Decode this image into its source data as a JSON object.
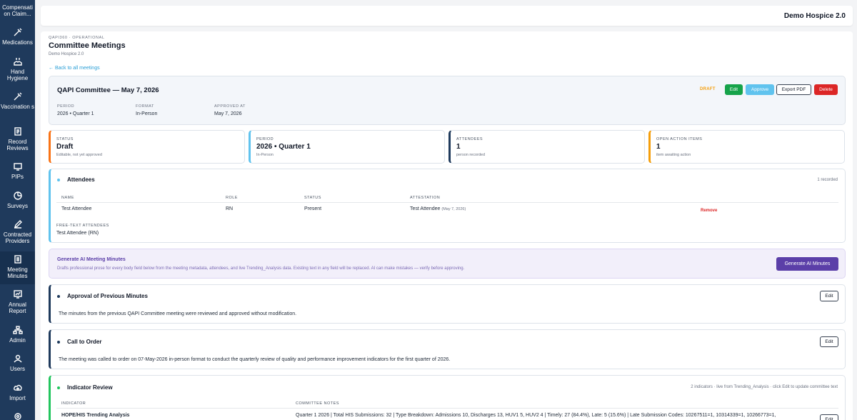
{
  "sidebar": {
    "items": [
      {
        "label": "Compensati on Claim...",
        "icon": "document-icon"
      },
      {
        "label": "Medications",
        "icon": "syringe-icon"
      },
      {
        "label": "Hand Hygiene",
        "icon": "hands-icon"
      },
      {
        "label": "Vaccination s",
        "icon": "syringe-icon"
      },
      {
        "label": "Record Reviews",
        "icon": "clipboard-icon"
      },
      {
        "label": "PIPs",
        "icon": "monitor-icon"
      },
      {
        "label": "Surveys",
        "icon": "pie-icon"
      },
      {
        "label": "Contracted Providers",
        "icon": "pen-icon"
      },
      {
        "label": "Meeting Minutes",
        "icon": "notes-icon"
      },
      {
        "label": "Annual Report",
        "icon": "report-icon"
      },
      {
        "label": "Admin",
        "icon": "sitemap-icon"
      },
      {
        "label": "Users",
        "icon": "user-icon"
      },
      {
        "label": "Import",
        "icon": "cloud-upload-icon"
      }
    ]
  },
  "topbar": {
    "org": "Demo Hospice 2.0"
  },
  "page": {
    "eyebrow": "QAPI360 · OPERATIONAL",
    "title": "Committee Meetings",
    "subtitle": "Demo Hospice 2.0",
    "back": "← Back to all meetings"
  },
  "meeting": {
    "title": "QAPI Committee — May 7, 2026",
    "status_badge": "DRAFT",
    "buttons": {
      "edit": "Edit",
      "approve": "Approve",
      "export": "Export PDF",
      "delete": "Delete"
    },
    "meta": [
      {
        "label": "PERIOD",
        "value": "2026 • Quarter 1"
      },
      {
        "label": "FORMAT",
        "value": "In-Person"
      },
      {
        "label": "APPROVED AT",
        "value": "May 7, 2026"
      }
    ]
  },
  "stats": [
    {
      "label": "STATUS",
      "value": "Draft",
      "sub": "Editable, not yet approved",
      "color": "#f97316"
    },
    {
      "label": "PERIOD",
      "value": "2026 • Quarter 1",
      "sub": "In-Person",
      "color": "#60c3ee"
    },
    {
      "label": "ATTENDEES",
      "value": "1",
      "sub": "person recorded",
      "color": "#1f3a5c"
    },
    {
      "label": "OPEN ACTION ITEMS",
      "value": "1",
      "sub": "item awaiting action",
      "color": "#f59e0b"
    }
  ],
  "attendees": {
    "title": "Attendees",
    "count": "1 recorded",
    "headers": [
      "NAME",
      "ROLE",
      "STATUS",
      "ATTESTATION"
    ],
    "row": {
      "name": "Test Attendee",
      "role": "RN",
      "status": "Present",
      "attestation": "Test Attendee",
      "attestation_date": "(May 7, 2026)",
      "remove": "Remove"
    },
    "free_text_label": "FREE-TEXT ATTENDEES",
    "free_text_value": "Test Attendee (RN)"
  },
  "ai": {
    "title": "Generate AI Meeting Minutes",
    "desc": "Drafts professional prose for every body field below from the meeting metadata, attendees, and live Trending_Analysis data. Existing text in any field will be replaced. AI can make mistakes — verify before approving.",
    "button": "Generate AI Minutes"
  },
  "sections": {
    "approval": {
      "title": "Approval of Previous Minutes",
      "body": "The minutes from the previous QAPI Committee meeting were reviewed and approved without modification.",
      "edit": "Edit"
    },
    "call": {
      "title": "Call to Order",
      "body": "The meeting was called to order on 07-May-2026 in-person format to conduct the quarterly review of quality and performance improvement indicators for the first quarter of 2026.",
      "edit": "Edit"
    }
  },
  "indicator_review": {
    "title": "Indicator Review",
    "note": "2 indicators · live from Trending_Analysis · click Edit to update committee text",
    "headers": [
      "INDICATOR",
      "COMMITTEE NOTES"
    ],
    "row": {
      "indicator": "HOPE/HIS Trending Analysis",
      "notes": "Quarter 1 2026 | Total HIS Submissions: 32 | Type Breakdown: Admissions 10, Discharges 13, HUV1 5, HUV2 4 | Timely: 27 (84.4%), Late: 5 (15.6%) | Late Submission Codes: 10267511=1, 10314339=1, 10266773=1,",
      "edit": "Edit"
    }
  }
}
